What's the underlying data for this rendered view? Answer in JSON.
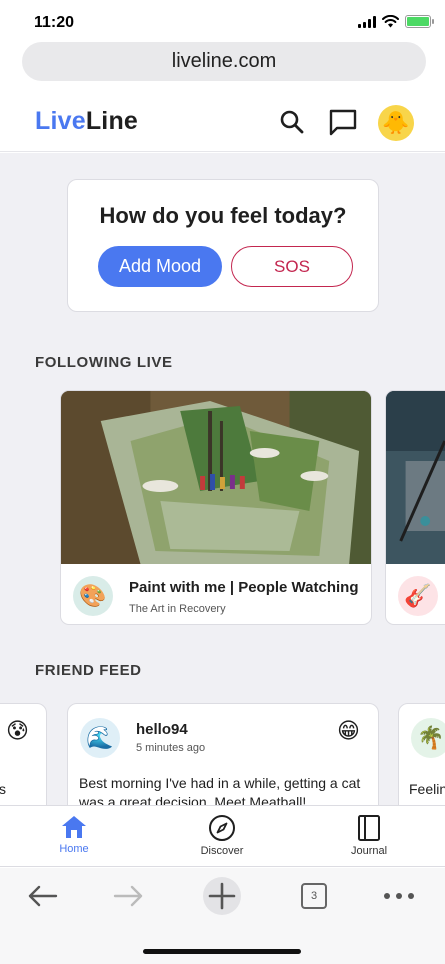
{
  "status": {
    "time": "11:20"
  },
  "browser": {
    "url": "liveline.com",
    "tabs_count": "3"
  },
  "header": {
    "logo_part1": "Live",
    "logo_part2": "Line",
    "avatar_emoji": "🐥"
  },
  "mood": {
    "title": "How do you feel today?",
    "add_label": "Add Mood",
    "sos_label": "SOS"
  },
  "following": {
    "section_title": "FOLLOWING LIVE",
    "cards": [
      {
        "title": "Paint with me | People Watching",
        "subtitle": "The Art in Recovery",
        "avatar_emoji": "🎨"
      },
      {
        "title": "",
        "subtitle": "",
        "avatar_emoji": "🎸"
      }
    ]
  },
  "feed": {
    "section_title": "FRIEND FEED",
    "left_partial": {
      "mood_emoji": "😰",
      "text": "s"
    },
    "main": {
      "username": "hello94",
      "time": "5 minutes ago",
      "mood_emoji": "😁",
      "avatar_emoji": "🌊",
      "text": "Best morning I've had in a while, getting a cat was a great decision. Meet Meatball!"
    },
    "right_partial": {
      "avatar_emoji": "🌴",
      "text": "Feelin"
    }
  },
  "nav": {
    "items": [
      {
        "label": "Home",
        "icon": "home-icon",
        "active": true
      },
      {
        "label": "Discover",
        "icon": "compass-icon",
        "active": false
      },
      {
        "label": "Journal",
        "icon": "journal-icon",
        "active": false
      }
    ]
  },
  "colors": {
    "accent": "#4a78f0",
    "sos": "#c3264f",
    "background": "#f0f0f4"
  }
}
